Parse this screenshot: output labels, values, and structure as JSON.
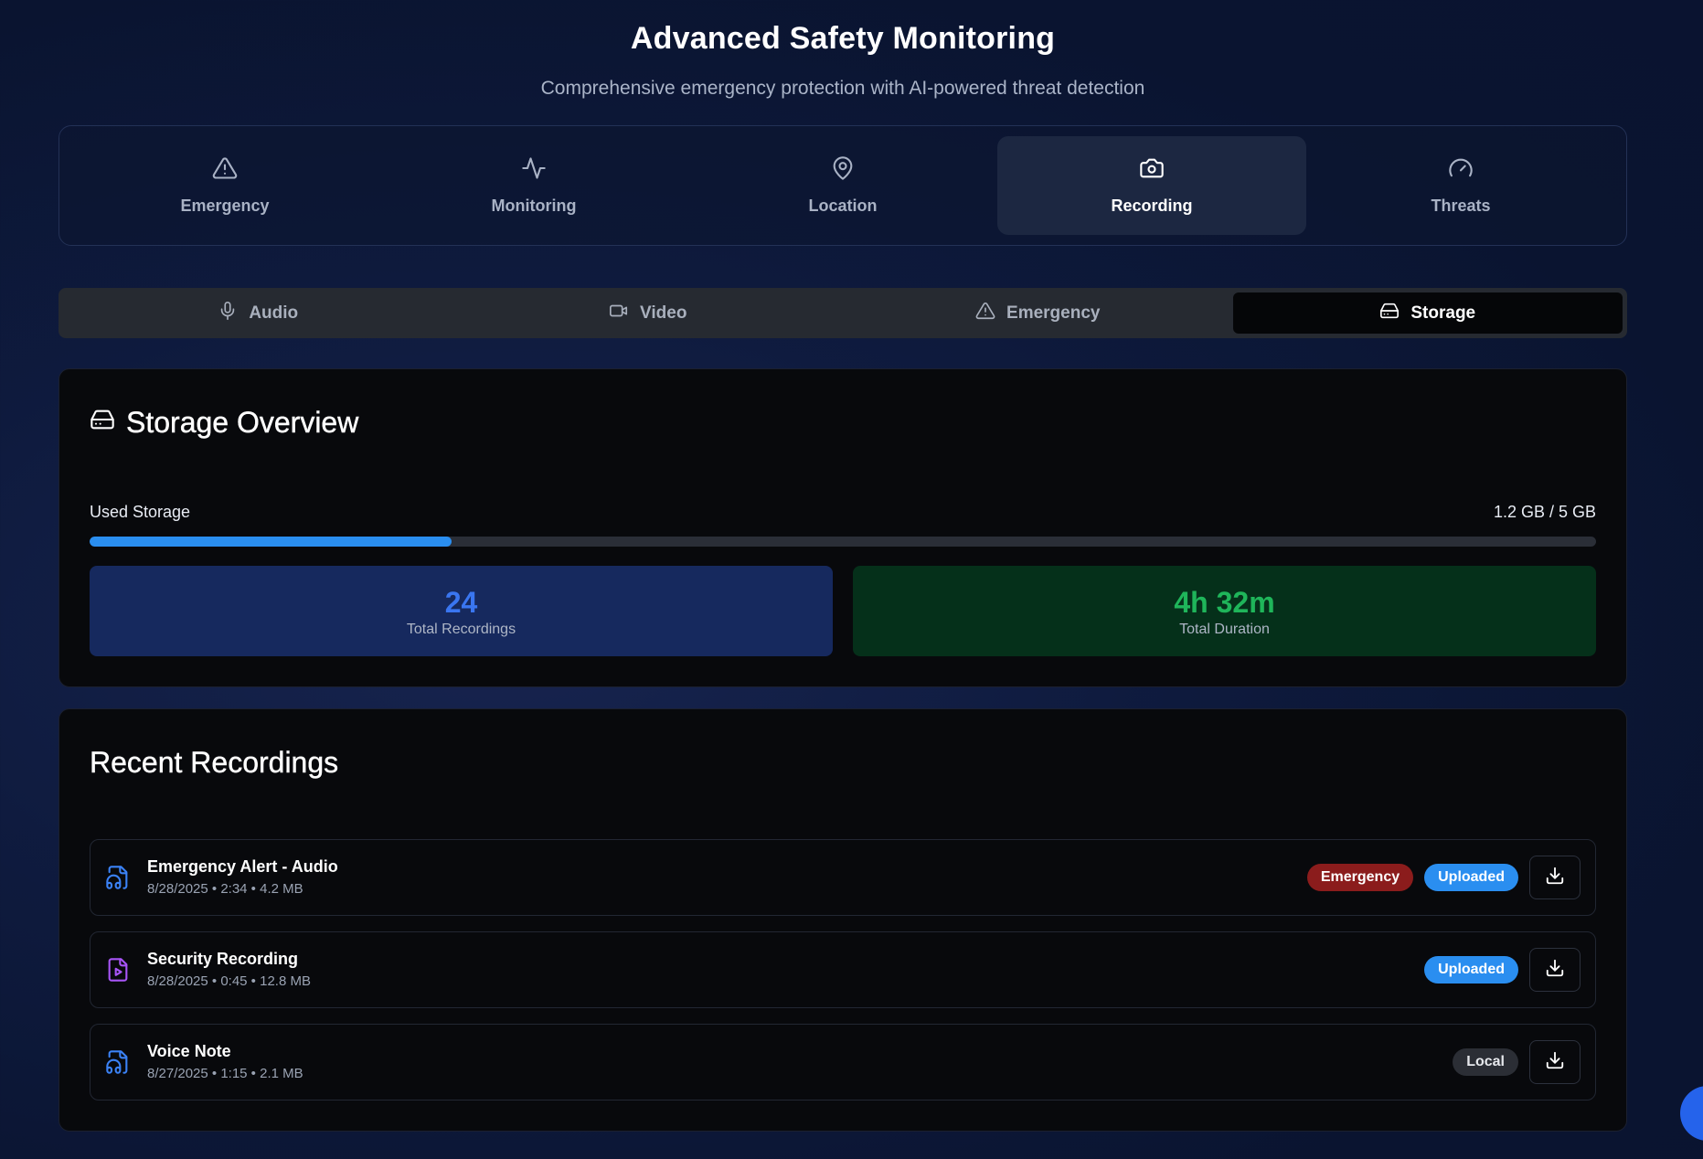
{
  "header": {
    "title": "Advanced Safety Monitoring",
    "subtitle": "Comprehensive emergency protection with AI-powered threat detection"
  },
  "main_tabs": [
    {
      "label": "Emergency",
      "icon": "alert-triangle-icon",
      "active": false
    },
    {
      "label": "Monitoring",
      "icon": "activity-icon",
      "active": false
    },
    {
      "label": "Location",
      "icon": "map-pin-icon",
      "active": false
    },
    {
      "label": "Recording",
      "icon": "camera-icon",
      "active": true
    },
    {
      "label": "Threats",
      "icon": "gauge-icon",
      "active": false
    }
  ],
  "sub_tabs": [
    {
      "label": "Audio",
      "icon": "mic-icon",
      "active": false
    },
    {
      "label": "Video",
      "icon": "video-icon",
      "active": false
    },
    {
      "label": "Emergency",
      "icon": "alert-triangle-icon",
      "active": false
    },
    {
      "label": "Storage",
      "icon": "hard-drive-icon",
      "active": true
    }
  ],
  "storage": {
    "title": "Storage Overview",
    "used_label": "Used Storage",
    "used_value": "1.2 GB / 5 GB",
    "used_fraction": 0.24,
    "total_recordings_value": "24",
    "total_recordings_label": "Total Recordings",
    "total_duration_value": "4h 32m",
    "total_duration_label": "Total Duration"
  },
  "recent": {
    "title": "Recent Recordings",
    "items": [
      {
        "name": "Emergency Alert - Audio",
        "meta": "8/28/2025 • 2:34 • 4.2 MB",
        "type": "audio",
        "badges": [
          "Emergency",
          "Uploaded"
        ]
      },
      {
        "name": "Security Recording",
        "meta": "8/28/2025 • 0:45 • 12.8 MB",
        "type": "video",
        "badges": [
          "Uploaded"
        ]
      },
      {
        "name": "Voice Note",
        "meta": "8/27/2025 • 1:15 • 2.1 MB",
        "type": "audio",
        "badges": [
          "Local"
        ]
      }
    ]
  },
  "colors": {
    "accent_blue": "#2a8ef0",
    "emergency_red": "#8b1c1c",
    "audio_icon": "#3b82f6",
    "video_icon": "#a855f7",
    "stat_blue": "#3a76f0",
    "stat_green": "#1fb55a"
  }
}
